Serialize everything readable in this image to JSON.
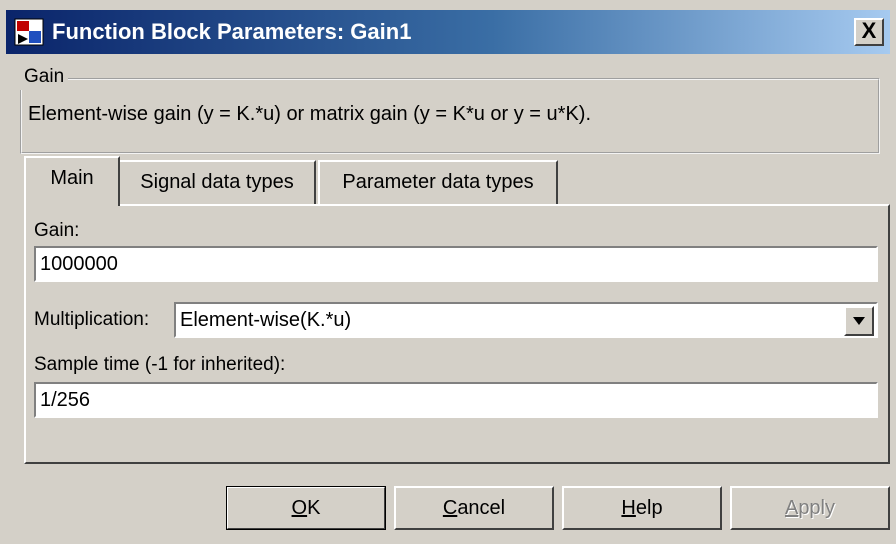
{
  "window": {
    "title": "Function Block Parameters: Gain1",
    "close_glyph": "X"
  },
  "group": {
    "legend": "Gain",
    "description": "Element-wise gain (y = K.*u) or matrix gain (y = K*u or y = u*K)."
  },
  "tabs": [
    {
      "label": "Main",
      "active": true
    },
    {
      "label": "Signal data types",
      "active": false
    },
    {
      "label": "Parameter data types",
      "active": false
    }
  ],
  "main": {
    "gain_label": "Gain:",
    "gain_value": "1000000",
    "multiplication_label": "Multiplication:",
    "multiplication_value": "Element-wise(K.*u)",
    "sample_time_label": "Sample time (-1 for inherited):",
    "sample_time_value": "1/256"
  },
  "buttons": {
    "ok": "OK",
    "cancel": "Cancel",
    "help": "Help",
    "apply": "Apply"
  },
  "colors": {
    "titlebar_start": "#0a246a",
    "titlebar_end": "#a6caf0",
    "face": "#d4d0c8"
  }
}
